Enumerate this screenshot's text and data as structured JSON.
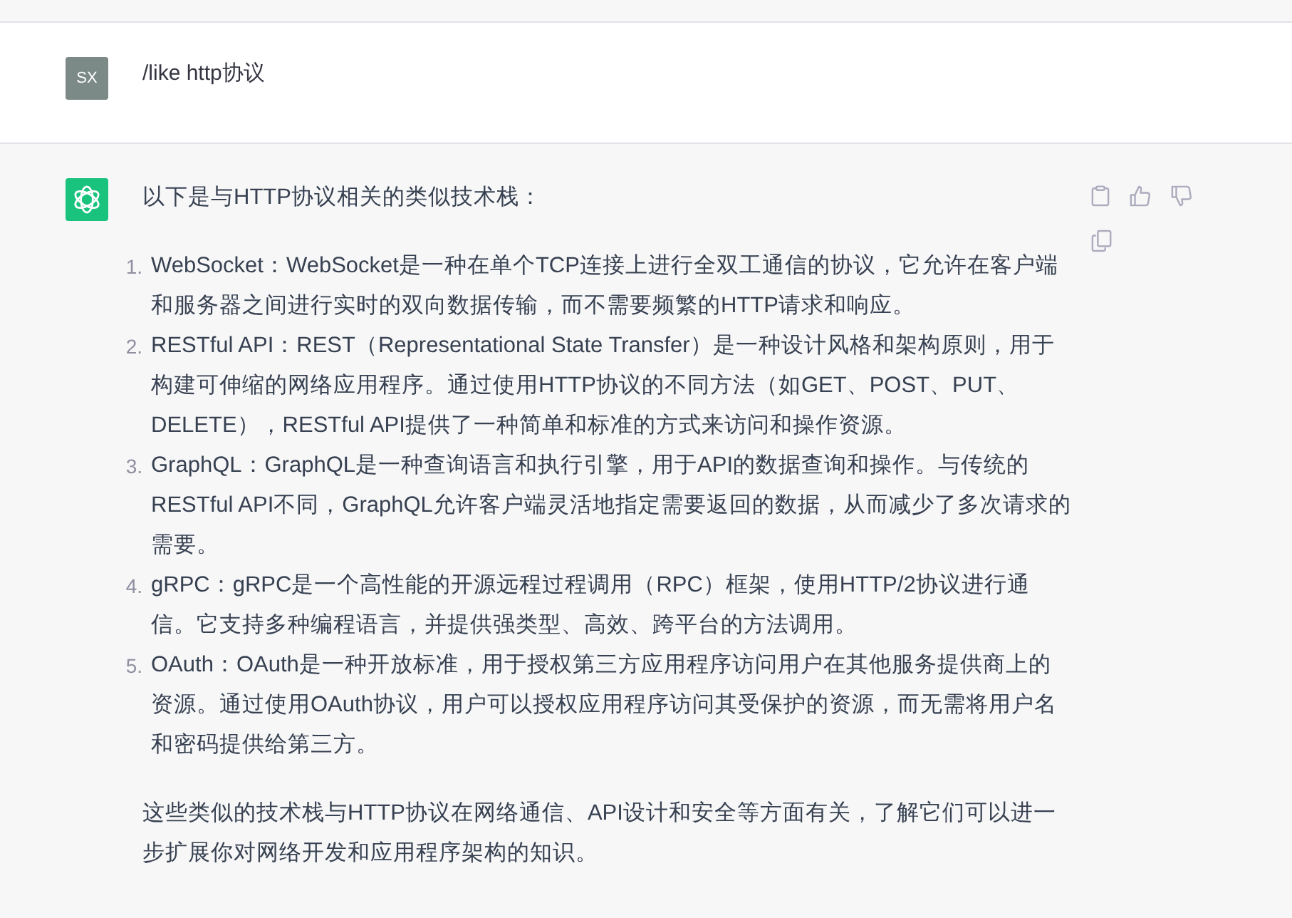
{
  "user_message": {
    "avatar": "SX",
    "text": "/like http协议"
  },
  "assistant_message": {
    "intro": "以下是与HTTP协议相关的类似技术栈：",
    "items": [
      {
        "number": "1.",
        "text": "WebSocket：WebSocket是一种在单个TCP连接上进行全双工通信的协议，它允许在客户端和服务器之间进行实时的双向数据传输，而不需要频繁的HTTP请求和响应。"
      },
      {
        "number": "2.",
        "text": "RESTful API：REST（Representational State Transfer）是一种设计风格和架构原则，用于构建可伸缩的网络应用程序。通过使用HTTP协议的不同方法（如GET、POST、PUT、DELETE），RESTful API提供了一种简单和标准的方式来访问和操作资源。"
      },
      {
        "number": "3.",
        "text": "GraphQL：GraphQL是一种查询语言和执行引擎，用于API的数据查询和操作。与传统的RESTful API不同，GraphQL允许客户端灵活地指定需要返回的数据，从而减少了多次请求的需要。"
      },
      {
        "number": "4.",
        "text": "gRPC：gRPC是一个高性能的开源远程过程调用（RPC）框架，使用HTTP/2协议进行通信。它支持多种编程语言，并提供强类型、高效、跨平台的方法调用。"
      },
      {
        "number": "5.",
        "text": "OAuth：OAuth是一种开放标准，用于授权第三方应用程序访问用户在其他服务提供商上的资源。通过使用OAuth协议，用户可以授权应用程序访问其受保护的资源，而无需将用户名和密码提供给第三方。"
      }
    ],
    "conclusion": "这些类似的技术栈与HTTP协议在网络通信、API设计和安全等方面有关，了解它们可以进一步扩展你对网络开发和应用程序架构的知识。"
  }
}
